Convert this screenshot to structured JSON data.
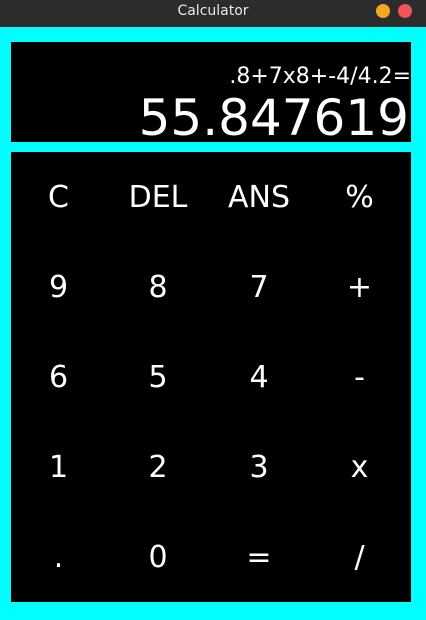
{
  "window": {
    "title": "Calculator",
    "controls": [
      "minimize",
      "close"
    ]
  },
  "display": {
    "expression": ".8+7x8+-4/4.2=",
    "result": "55.847619"
  },
  "keypad": {
    "keys": [
      {
        "label": "C"
      },
      {
        "label": "DEL"
      },
      {
        "label": "ANS"
      },
      {
        "label": "%"
      },
      {
        "label": "9"
      },
      {
        "label": "8"
      },
      {
        "label": "7"
      },
      {
        "label": "+"
      },
      {
        "label": "6"
      },
      {
        "label": "5"
      },
      {
        "label": "4"
      },
      {
        "label": "-"
      },
      {
        "label": "1"
      },
      {
        "label": "2"
      },
      {
        "label": "3"
      },
      {
        "label": "x"
      },
      {
        "label": "."
      },
      {
        "label": "0"
      },
      {
        "label": "="
      },
      {
        "label": "/"
      }
    ]
  },
  "colors": {
    "frame": "#00ffff",
    "panel": "#000000",
    "text": "#ffffff",
    "titlebar": "#2c2c2c",
    "minimize": "#f5a623",
    "close": "#f0545c"
  }
}
